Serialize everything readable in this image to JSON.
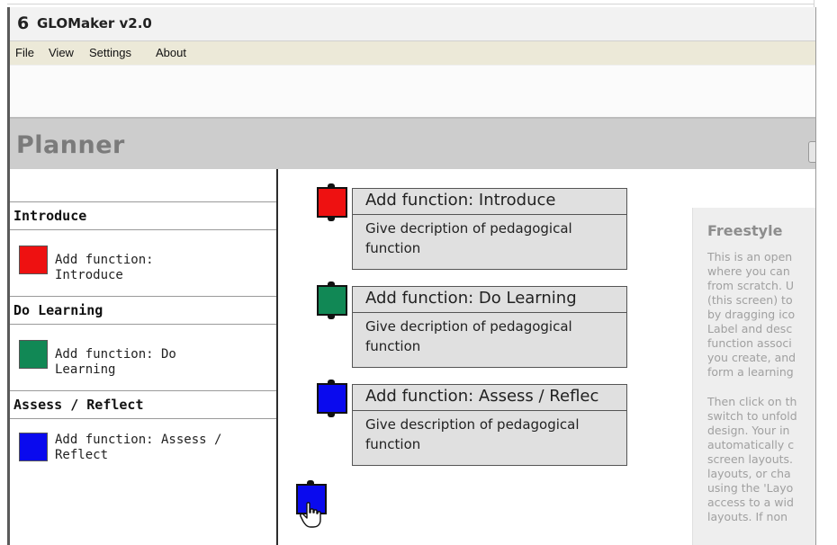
{
  "app": {
    "title": "GLOMaker v2.0",
    "logo_glyph": "6"
  },
  "menu": [
    "File",
    "View",
    "Settings",
    "About"
  ],
  "header": {
    "title": "Planner"
  },
  "sidebar": {
    "sections": [
      {
        "heading": "Introduce",
        "item_label": "Add function: Introduce",
        "color": "#ee1111"
      },
      {
        "heading": "Do Learning",
        "item_label": "Add function: Do Learning",
        "color": "#118855"
      },
      {
        "heading": "Assess / Reflect",
        "item_label": "Add function: Assess / Reflect",
        "color": "#0a0aee"
      }
    ]
  },
  "canvas": {
    "nodes": [
      {
        "title": "Add function: Introduce",
        "desc": "Give decription of pedagogical function",
        "color": "#ee1111"
      },
      {
        "title": "Add function: Do Learning",
        "desc": "Give decription of pedagogical function",
        "color": "#118855"
      },
      {
        "title": "Add function: Assess / Reflec",
        "desc": "Give description of pedagogical function",
        "color": "#0a0aee"
      }
    ],
    "dragging_block": {
      "color": "#0a0aee"
    }
  },
  "help": {
    "heading": "Freestyle",
    "para1": "This is an open\nwhere you can\nfrom scratch. U\n(this screen) to\nby dragging ico\nLabel and desc\nfunction associ\nyou create, and\nform a learning",
    "para2": "Then click on th\nswitch to unfold\ndesign. Your in\nautomatically c\nscreen layouts.\nlayouts, or cha\nusing the 'Layo\naccess to a wid\nlayouts. If non"
  },
  "colors": {
    "introduce": "#ee1111",
    "do_learning": "#118855",
    "assess_reflect": "#0a0aee"
  }
}
